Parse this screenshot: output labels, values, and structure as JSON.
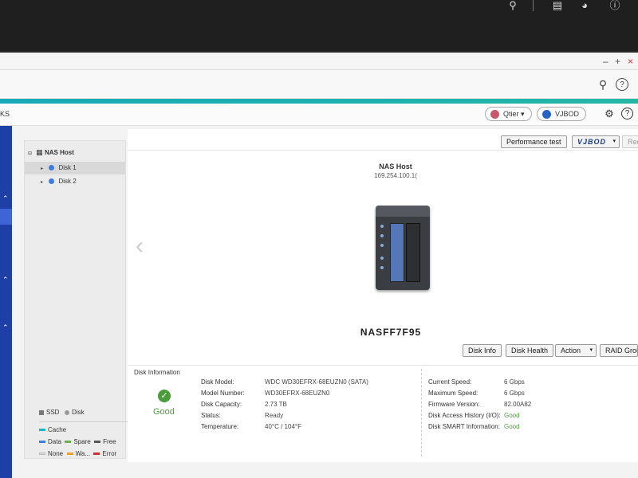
{
  "subheader": {
    "partial_label": "KS"
  },
  "tags": {
    "qtier": "Qtier",
    "vjbod": "VJBOD"
  },
  "toolbar": {
    "performance_test": "Performance test",
    "vjbod": "VJBOD",
    "truncated": "Rec"
  },
  "tree": {
    "root": "NAS Host",
    "items": [
      {
        "label": "Disk 1"
      },
      {
        "label": "Disk 2"
      }
    ]
  },
  "legend": {
    "ssd": "SSD",
    "disk": "Disk",
    "cache": "Cache",
    "data": "Data",
    "spare": "Spare",
    "free": "Free",
    "none": "None",
    "warning": "Wa...",
    "error": "Error"
  },
  "device": {
    "host_label": "NAS Host",
    "ip": "169.254.100.1(",
    "name": "NASFF7F95"
  },
  "actions": {
    "disk_info": "Disk Info",
    "disk_health": "Disk Health",
    "action": "Action",
    "raid_group": "RAID Group"
  },
  "disk_information": {
    "section_title": "Disk Information",
    "status_summary": "Good",
    "left": [
      {
        "label": "Disk Model:",
        "value": "WDC WD30EFRX-68EUZN0 (SATA)"
      },
      {
        "label": "Model Number:",
        "value": "WD30EFRX-68EUZN0"
      },
      {
        "label": "Disk Capacity:",
        "value": "2.73 TB"
      },
      {
        "label": "Status:",
        "value": "Ready"
      },
      {
        "label": "Temperature:",
        "value": "40°C / 104°F"
      }
    ],
    "right": [
      {
        "label": "Current Speed:",
        "value": "6 Gbps"
      },
      {
        "label": "Maximum Speed:",
        "value": "6 Gbps"
      },
      {
        "label": "Firmware Version:",
        "value": "82.00A82"
      },
      {
        "label": "Disk Access History (I/O):",
        "value": "Good"
      },
      {
        "label": "Disk SMART Information:",
        "value": "Good"
      }
    ]
  },
  "colors": {
    "accent": "#1aa9b8",
    "rail": "#1e3fa6",
    "good": "#4a9d3a",
    "ssd": "#777777",
    "disk": "#999999",
    "cache": "#18b4c9",
    "data": "#3b7de0",
    "spare": "#6ab04c",
    "free": "#555555",
    "none": "#dddddd",
    "warning": "#f0a030",
    "error": "#d0312d"
  }
}
